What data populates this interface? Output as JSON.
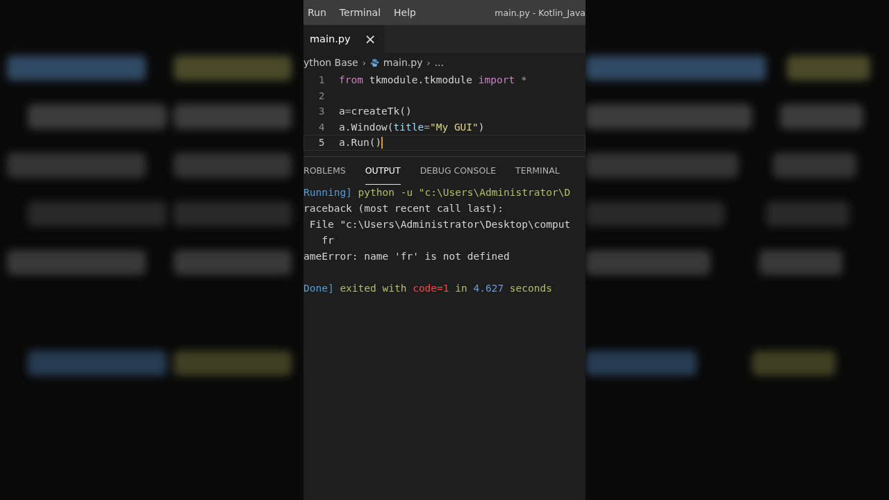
{
  "menu": {
    "items": [
      "Run",
      "Terminal",
      "Help"
    ],
    "title": "main.py - Kotlin_Java"
  },
  "tabs": [
    {
      "label": "main.py",
      "close": "×",
      "selected": true
    }
  ],
  "breadcrumb": [
    "ython Base",
    "main.py",
    "..."
  ],
  "breadcrumb_separator": "›",
  "code": [
    {
      "number": "1",
      "current": false,
      "segments": [
        {
          "kind": "keyword",
          "text": "from"
        },
        {
          "kind": "plain",
          "text": " tkmodule.tkmodule "
        },
        {
          "kind": "keyword",
          "text": "import"
        },
        {
          "kind": "dim",
          "text": " *"
        }
      ]
    },
    {
      "number": "2",
      "current": false
    },
    {
      "number": "3",
      "current": false,
      "segments": [
        {
          "kind": "plain",
          "text": "a"
        },
        {
          "kind": "dim",
          "text": "="
        },
        {
          "kind": "plain",
          "text": "createTk()"
        }
      ]
    },
    {
      "number": "4",
      "current": false,
      "segments": [
        {
          "kind": "plain",
          "text": "a.Window("
        },
        {
          "kind": "param",
          "text": "title"
        },
        {
          "kind": "dim",
          "text": "="
        },
        {
          "kind": "string",
          "text": "\"My GUI\""
        },
        {
          "kind": "plain",
          "text": ")"
        }
      ]
    },
    {
      "number": "5",
      "current": true,
      "segments": [
        {
          "kind": "plain",
          "text": "a.Run()"
        }
      ]
    }
  ],
  "panel_tabs": [
    {
      "label": "ROBLEMS",
      "selected": false
    },
    {
      "label": "OUTPUT",
      "selected": true
    },
    {
      "label": "DEBUG CONSOLE",
      "selected": false
    },
    {
      "label": "TERMINAL",
      "selected": false
    }
  ],
  "output": [
    {
      "lines": [
        {
          "segments": [
            {
              "kind": "tag",
              "text": "Running]"
            },
            {
              "kind": "info",
              "text": " python -u \"c:\\Users\\Administrator\\D"
            }
          ]
        },
        {
          "segments": [
            {
              "kind": "plain",
              "text": "raceback (most recent call last):"
            }
          ]
        },
        {
          "segments": [
            {
              "kind": "plain",
              "text": " File \"c:\\Users\\Administrator\\Desktop\\comput"
            }
          ]
        },
        {
          "segments": [
            {
              "kind": "plain",
              "text": "   fr"
            }
          ]
        },
        {
          "segments": [
            {
              "kind": "plain",
              "text": "ameError: name 'fr' is not defined"
            }
          ]
        }
      ]
    },
    {
      "lines": [
        {
          "segments": [
            {
              "kind": "tag",
              "text": "Done]"
            },
            {
              "kind": "info",
              "text": " exited with "
            },
            {
              "kind": "error",
              "text": "code=1"
            },
            {
              "kind": "info",
              "text": " in "
            },
            {
              "kind": "number",
              "text": "4.627"
            },
            {
              "kind": "info",
              "text": " seconds"
            }
          ]
        }
      ]
    }
  ]
}
